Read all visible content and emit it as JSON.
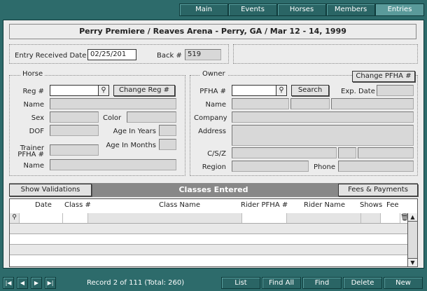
{
  "nav": {
    "tabs": [
      {
        "label": "Main",
        "active": false
      },
      {
        "label": "Events",
        "active": false
      },
      {
        "label": "Horses",
        "active": false
      },
      {
        "label": "Members",
        "active": false
      },
      {
        "label": "Entries",
        "active": true
      }
    ]
  },
  "event": {
    "title": "Perry Premiere / Reaves Arena - Perry, GA / Mar 12 - 14, 1999"
  },
  "entry": {
    "received_label": "Entry Received Date",
    "received_value": "02/25/201",
    "back_label": "Back #",
    "back_value": "519"
  },
  "horse": {
    "legend": "Horse",
    "reg_label": "Reg #",
    "reg_value": "",
    "change_reg_button": "Change Reg #",
    "name_label": "Name",
    "sex_label": "Sex",
    "color_label": "Color",
    "dof_label": "DOF",
    "age_years_label": "Age In Years",
    "age_months_label": "Age In Months",
    "trainer_label_1": "Trainer",
    "trainer_label_2": "PFHA #",
    "trainer_name_label": "Name"
  },
  "owner": {
    "legend": "Owner",
    "change_pfha_button": "Change PFHA #",
    "pfha_label": "PFHA #",
    "search_button": "Search",
    "exp_date_label": "Exp. Date",
    "name_label": "Name",
    "company_label": "Company",
    "address_label": "Address",
    "csz_label": "C/S/Z",
    "region_label": "Region",
    "phone_label": "Phone"
  },
  "classes": {
    "show_validations_button": "Show Validations",
    "title": "Classes Entered",
    "fees_button": "Fees & Payments",
    "columns": [
      "Date",
      "Class #",
      "Class Name",
      "Rider PFHA #",
      "Rider Name",
      "Shows",
      "Fee"
    ]
  },
  "footer": {
    "record_status": "Record 2 of 111  (Total: 260)",
    "buttons": [
      "List",
      "Find All",
      "Find",
      "Delete",
      "New"
    ]
  }
}
